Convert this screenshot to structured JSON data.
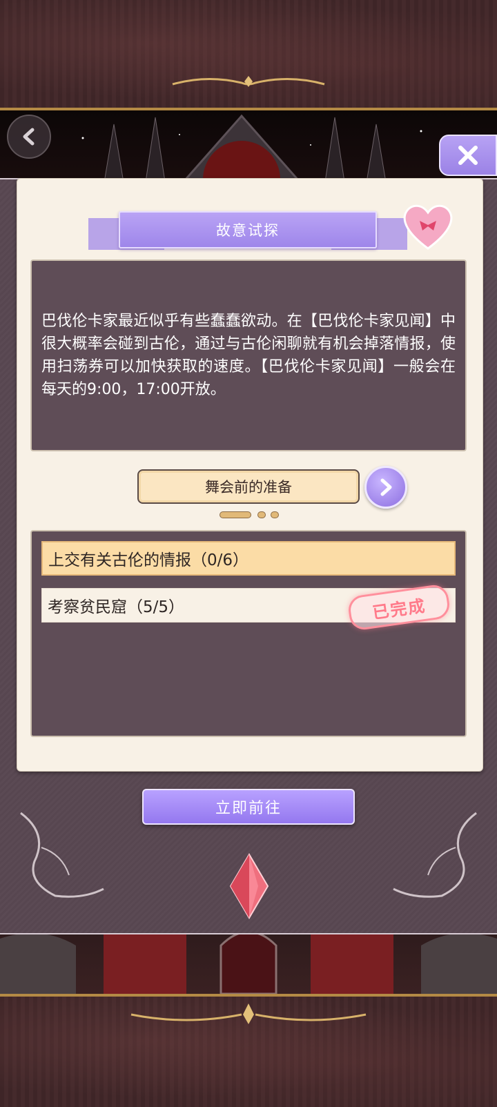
{
  "header": {
    "back_icon": "chevron-left-icon",
    "close_icon": "close-x-icon"
  },
  "quest": {
    "title": "故意试探",
    "description": "巴伐伦卡家最近似乎有些蠢蠢欲动。在【巴伐伦卡家见闻】中很大概率会碰到古伦，通过与古伦闲聊就有机会掉落情报，使用扫荡券可以加快获取的速度。【巴伐伦卡家见闻】一般会在每天的9:00，17:00开放。",
    "stage_label": "舞会前的准备",
    "page_indicator": {
      "total": 3,
      "active": 1
    }
  },
  "tasks": [
    {
      "label": "上交有关古伦的情报（0/6）",
      "completed": false
    },
    {
      "label": "考察贫民窟（5/5）",
      "completed": true,
      "stamp": "已完成"
    }
  ],
  "actions": {
    "go_label": "立即前往"
  },
  "colors": {
    "accent_purple": "#a58cf0",
    "panel": "#5f4d57",
    "cream": "#f8f1e6",
    "task_highlight": "#fbdca6",
    "stamp_pink": "#ff7a8a"
  }
}
